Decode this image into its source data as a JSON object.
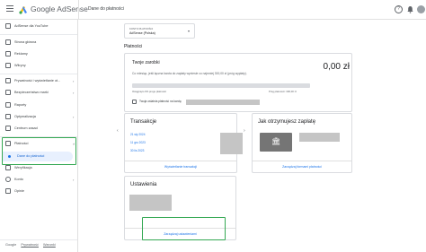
{
  "topbar": {
    "brand": "Google AdSense",
    "page_title": "Dane do płatności",
    "help_glyph": "?"
  },
  "sidebar": {
    "items": [
      {
        "label": "AdSense dla YouTube",
        "icon": "youtube-icon"
      },
      {
        "label": "Strona główna",
        "icon": "home-icon"
      },
      {
        "label": "Reklamy",
        "icon": "ads-icon"
      },
      {
        "label": "Witryny",
        "icon": "sites-icon"
      },
      {
        "label": "Prywatność i wyświetlanie ot...",
        "icon": "privacy-icon",
        "chevron": "›"
      },
      {
        "label": "Bezpieczeństwo marki",
        "icon": "shield-icon",
        "chevron": "›"
      },
      {
        "label": "Raporty",
        "icon": "reports-icon"
      },
      {
        "label": "Optymalizacja",
        "icon": "optimization-icon",
        "chevron": "›"
      },
      {
        "label": "Centrum zasad",
        "icon": "policy-icon"
      },
      {
        "label": "Płatności",
        "icon": "payments-icon",
        "chevron": "˄"
      },
      {
        "label": "Weryfikacja",
        "icon": "verification-icon"
      },
      {
        "label": "Konto",
        "icon": "gear-icon",
        "chevron": "›"
      },
      {
        "label": "Opinie",
        "icon": "feedback-icon"
      }
    ],
    "active_sub": "Dane do płatności",
    "footer": {
      "google": "Google",
      "privacy": "Prywatność",
      "terms": "Warunki"
    }
  },
  "account_selector": {
    "label": "KONTO PŁATNOŚCI",
    "value": "AdSense (Polska)",
    "chevron": "▾"
  },
  "section_title": "Płatności",
  "earnings": {
    "title": "Twoje zarobki",
    "amount": "0,00 zł",
    "info": "Co miesiąc, jeśli łączna kwota do zapłaty wyniesie co najmniej 300,00 zł (próg wypłaty).",
    "progress_fraction": 0.0,
    "bar_left": "Osiągnięto 0% progu płatności",
    "bar_right": "Próg płatności: 300,00 zł",
    "last_payment": "Twoja ostatnia płatność na kwotę"
  },
  "transactions": {
    "title": "Transakcje",
    "items": [
      "21 sty 2024",
      "11 gru 2023",
      "30 lis 2023"
    ],
    "link": "Wyświetlanie transakcji"
  },
  "payment_method": {
    "title": "Jak otrzymujesz zapłatę",
    "link": "Zarządzaj formami płatności"
  },
  "settings": {
    "title": "Ustawienia",
    "link": "Zarządzaj ustawieniami"
  }
}
